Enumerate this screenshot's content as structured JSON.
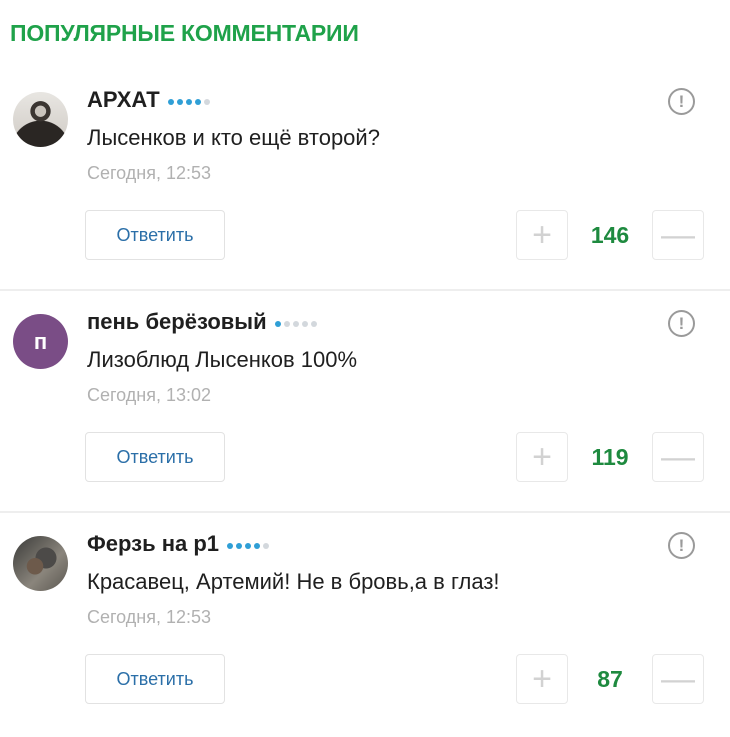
{
  "section": {
    "title": "ПОПУЛЯРНЫЕ КОММЕНТАРИИ"
  },
  "colors": {
    "title_green": "#1fa24a",
    "score_green": "#1e8a3f",
    "rating_blue": "#2f9fd6",
    "reply_blue": "#2b6fa8"
  },
  "comments": [
    {
      "author": "АРХАТ",
      "rating_level": 4,
      "rating_max": 5,
      "text": "Лысенков и кто ещё второй?",
      "time": "Сегодня, 12:53",
      "reply_label": "Ответить",
      "score": "146",
      "avatar": {
        "type": "photo"
      }
    },
    {
      "author": "пень берёзовый",
      "rating_level": 1,
      "rating_max": 5,
      "text": "Лизоблюд Лысенков 100%",
      "time": "Сегодня, 13:02",
      "reply_label": "Ответить",
      "score": "119",
      "avatar": {
        "type": "letter",
        "letter": "п",
        "color": "#7a4d86"
      }
    },
    {
      "author": "Ферзь на р1",
      "rating_level": 4,
      "rating_max": 5,
      "text": "Красавец, Артемий! Не в бровь,а в глаз!",
      "time": "Сегодня, 12:53",
      "reply_label": "Ответить",
      "score": "87",
      "avatar": {
        "type": "photo"
      }
    }
  ],
  "icons": {
    "report": "report-icon",
    "plus": "plus-icon",
    "minus": "minus-icon"
  }
}
